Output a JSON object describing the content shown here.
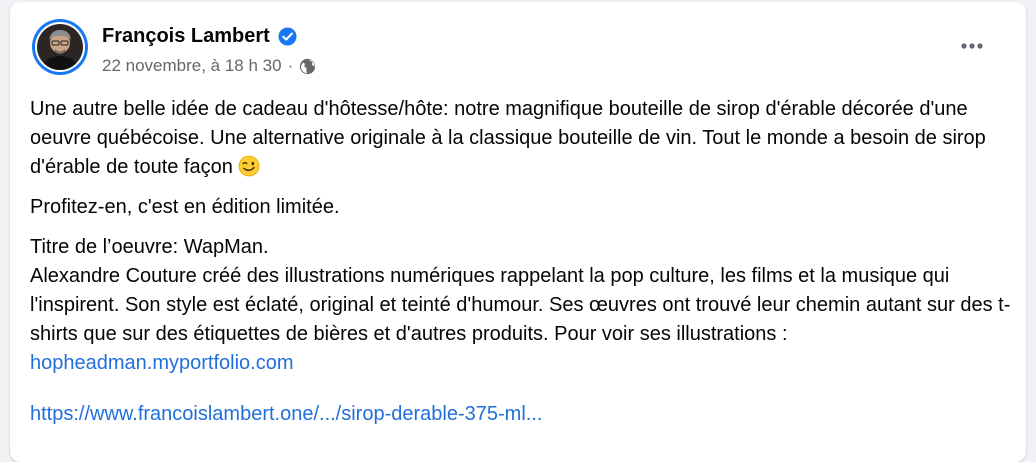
{
  "post": {
    "author": "François Lambert",
    "date": "22 novembre, à 18 h 30",
    "separator": "·",
    "paragraph1": "Une autre belle idée de cadeau d'hôtesse/hôte: notre magnifique bouteille de sirop d'érable décorée d'une oeuvre québécoise. Une alternative originale à la classique bouteille de vin. Tout le monde a besoin de sirop d'érable de toute façon",
    "paragraph2": "Profitez-en, c'est en édition limitée.",
    "artwork_title": "Titre de l’oeuvre: WapMan.",
    "artist_text": "Alexandre Couture créé des illustrations numériques rappelant la pop culture, les films et la musique qui l'inspirent. Son style est éclaté, original et teinté d'humour. Ses œuvres ont trouvé leur chemin autant sur des t-shirts que sur des étiquettes de bières et d'autres produits. Pour voir ses illustrations :",
    "portfolio_link": "hopheadman.myportfolio.com",
    "product_link": "https://www.francoislambert.one/.../sirop-derable-375-ml..."
  },
  "icons": {
    "verified": "verified-badge-icon",
    "audience": "globe-icon",
    "more": "more-options-icon",
    "emoji": "winking-face-emoji"
  },
  "colors": {
    "link": "#216fdb",
    "verified": "#1877f2",
    "meta": "#65676b",
    "text": "#050505"
  }
}
